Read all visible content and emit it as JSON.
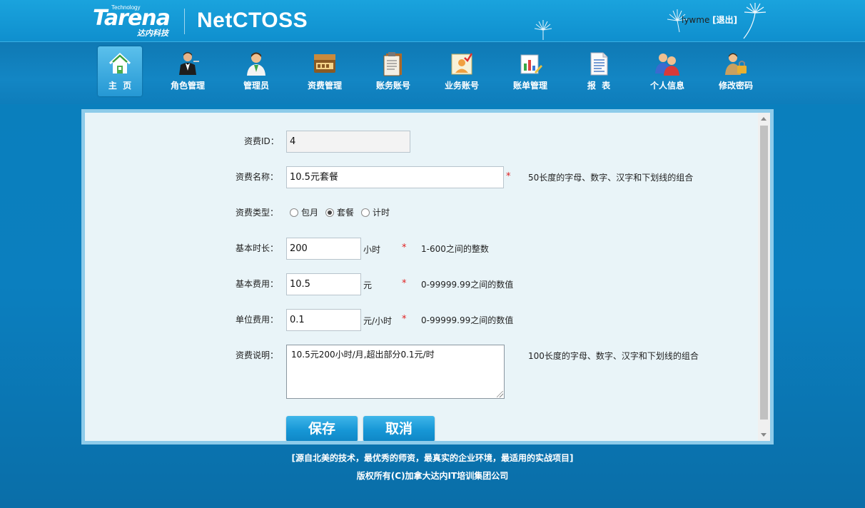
{
  "header": {
    "logo_brand": "Tarena",
    "logo_tech": "Technology",
    "logo_sub": "达内科技",
    "app_name": "NetCTOSS",
    "user": "lywme",
    "logout": "[退出]"
  },
  "nav": {
    "items": [
      {
        "label": "主  页",
        "icon": "home-icon"
      },
      {
        "label": "角色管理",
        "icon": "waiter-icon"
      },
      {
        "label": "管理员",
        "icon": "admin-user-icon"
      },
      {
        "label": "资费管理",
        "icon": "fee-card-icon"
      },
      {
        "label": "账务账号",
        "icon": "account-book-icon"
      },
      {
        "label": "业务账号",
        "icon": "service-account-icon"
      },
      {
        "label": "账单管理",
        "icon": "bill-icon"
      },
      {
        "label": "报  表",
        "icon": "report-icon"
      },
      {
        "label": "个人信息",
        "icon": "users-icon"
      },
      {
        "label": "修改密码",
        "icon": "lock-user-icon"
      }
    ]
  },
  "form": {
    "fee_id": {
      "label": "资费ID：",
      "value": "4"
    },
    "fee_name": {
      "label": "资费名称：",
      "value": "10.5元套餐",
      "required": "*",
      "hint": "50长度的字母、数字、汉字和下划线的组合"
    },
    "fee_type": {
      "label": "资费类型：",
      "options": [
        "包月",
        "套餐",
        "计时"
      ],
      "selected": "套餐"
    },
    "base_duration": {
      "label": "基本时长：",
      "value": "200",
      "unit": "小时",
      "required": "*",
      "hint": "1-600之间的整数"
    },
    "base_cost": {
      "label": "基本费用：",
      "value": "10.5",
      "unit": "元",
      "required": "*",
      "hint": "0-99999.99之间的数值"
    },
    "unit_cost": {
      "label": "单位费用：",
      "value": "0.1",
      "unit": "元/小时",
      "required": "*",
      "hint": "0-99999.99之间的数值"
    },
    "description": {
      "label": "资费说明：",
      "value": "10.5元200小时/月,超出部分0.1元/时",
      "hint": "100长度的字母、数字、汉字和下划线的组合"
    },
    "save_label": "保存",
    "cancel_label": "取消"
  },
  "footer": {
    "slogan": "[源自北美的技术，最优秀的师资，最真实的企业环境，最适用的实战项目]",
    "copyright": "版权所有(C)加拿大达内IT培训集团公司"
  },
  "colors": {
    "brand_blue": "#0f8fce",
    "button_blue": "#1797d6",
    "panel_bg": "#e9f4f8",
    "required_red": "#e02020"
  }
}
